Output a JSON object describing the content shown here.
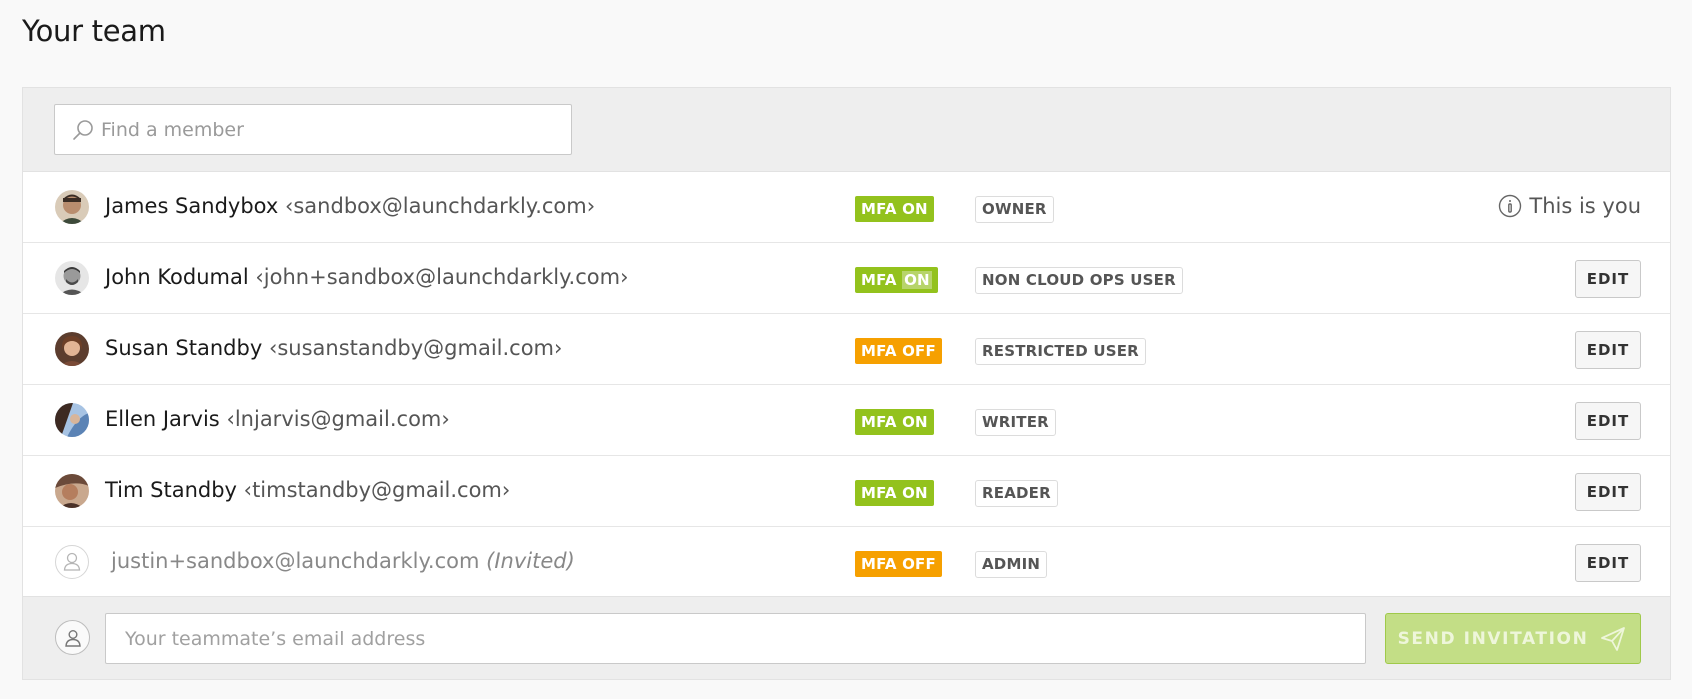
{
  "page": {
    "title": "Your team"
  },
  "search": {
    "placeholder": "Find a member",
    "icon": "search-icon"
  },
  "members": [
    {
      "name": "James Sandybox",
      "email": "‹sandbox@launchdarkly.com›",
      "mfa": "MFA ON",
      "role": "OWNER",
      "action": "This is you",
      "avatar_color": "#4a3b33"
    },
    {
      "name": "John Kodumal",
      "email": "‹john+sandbox@launchdarkly.com›",
      "mfa_prefix": "MFA ",
      "mfa_highlight": "ON",
      "role": "NON CLOUD OPS USER",
      "action": "EDIT",
      "avatar_color": "#8a8a8a"
    },
    {
      "name": "Susan Standby",
      "email": "‹susanstandby@gmail.com›",
      "mfa": "MFA OFF",
      "role": "RESTRICTED USER",
      "action": "EDIT",
      "avatar_color": "#7a4a36"
    },
    {
      "name": "Ellen Jarvis",
      "email": "‹lnjarvis@gmail.com›",
      "mfa": "MFA ON",
      "role": "WRITER",
      "action": "EDIT",
      "avatar_color": "#5b83b5"
    },
    {
      "name": "Tim Standby",
      "email": "‹timstandby@gmail.com›",
      "mfa": "MFA ON",
      "role": "READER",
      "action": "EDIT",
      "avatar_color": "#6b4a3a"
    },
    {
      "email": "justin+sandbox@launchdarkly.com",
      "invited_tag": "(Invited)",
      "mfa": "MFA OFF",
      "role": "ADMIN",
      "action": "EDIT"
    }
  ],
  "invite": {
    "placeholder": "Your teammate’s email address",
    "button_label": "SEND INVITATION",
    "button_icon": "paper-plane-icon"
  },
  "colors": {
    "mfa_on": "#93c21d",
    "mfa_off": "#f6a000",
    "send_button": "#c3de86"
  }
}
